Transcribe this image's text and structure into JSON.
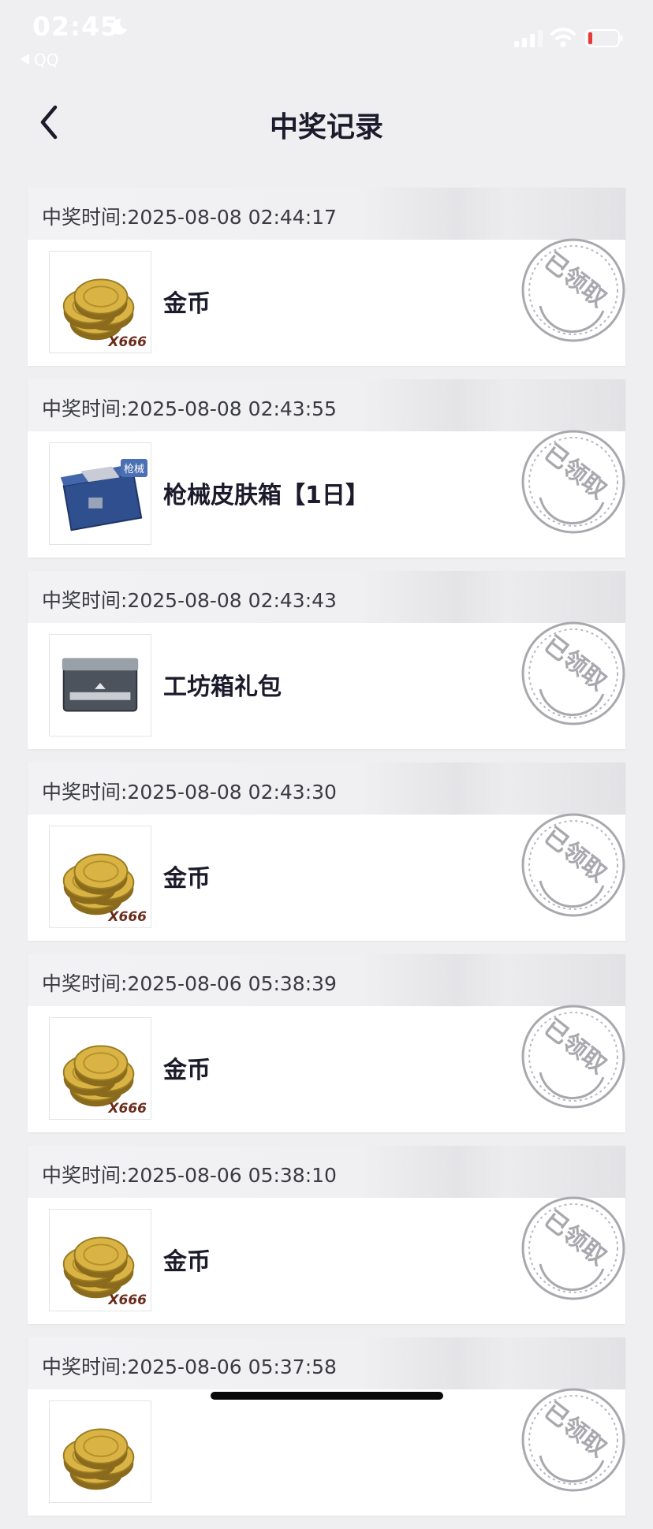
{
  "status_bar": {
    "time": "02:45",
    "back_app": "QQ"
  },
  "nav": {
    "title": "中奖记录"
  },
  "stamp_text": "已领取",
  "records": [
    {
      "time": "中奖时间:2025-08-08 02:44:17",
      "name": "金币",
      "icon": "gold-coins",
      "qty": "X666"
    },
    {
      "time": "中奖时间:2025-08-08 02:43:55",
      "name": "枪械皮肤箱【1日】",
      "icon": "weapon-skin-crate",
      "tag": "枪械"
    },
    {
      "time": "中奖时间:2025-08-08 02:43:43",
      "name": "工坊箱礼包",
      "icon": "workshop-box"
    },
    {
      "time": "中奖时间:2025-08-08 02:43:30",
      "name": "金币",
      "icon": "gold-coins",
      "qty": "X666"
    },
    {
      "time": "中奖时间:2025-08-06 05:38:39",
      "name": "金币",
      "icon": "gold-coins",
      "qty": "X666"
    },
    {
      "time": "中奖时间:2025-08-06 05:38:10",
      "name": "金币",
      "icon": "gold-coins",
      "qty": "X666"
    },
    {
      "time": "中奖时间:2025-08-06 05:37:58",
      "name": "",
      "icon": "gold-coins"
    }
  ],
  "colors": {
    "background": "#efeff1",
    "card": "#ffffff",
    "title_text": "#1c1b2b",
    "stamp": "#a8a8ae"
  }
}
